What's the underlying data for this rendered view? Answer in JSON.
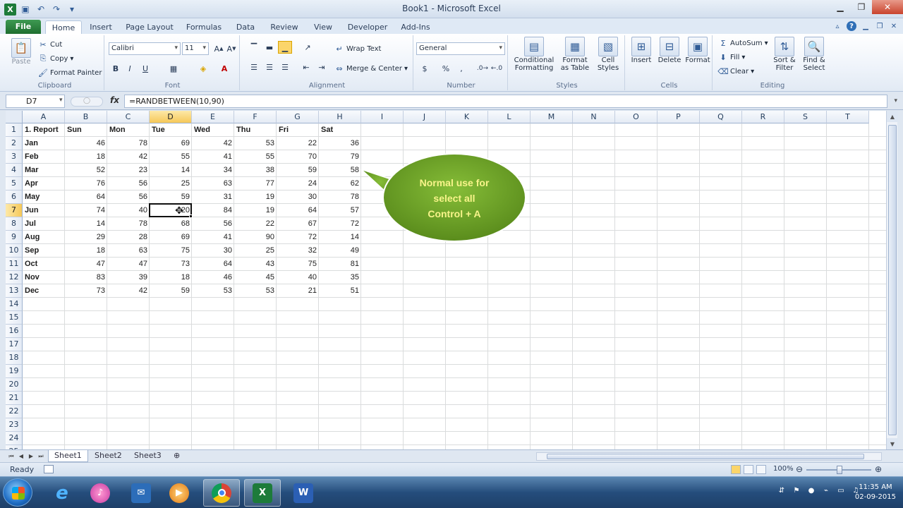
{
  "window": {
    "title": "Book1 - Microsoft Excel",
    "app_icon_letter": "X"
  },
  "tabs": [
    "File",
    "Home",
    "Insert",
    "Page Layout",
    "Formulas",
    "Data",
    "Review",
    "View",
    "Developer",
    "Add-Ins"
  ],
  "ribbon": {
    "clipboard": {
      "paste": "Paste",
      "cut": "Cut",
      "copy": "Copy",
      "format_painter": "Format Painter",
      "label": "Clipboard"
    },
    "font": {
      "name": "Calibri",
      "size": "11",
      "bold": "B",
      "italic": "I",
      "underline": "U",
      "label": "Font"
    },
    "alignment": {
      "wrap": "Wrap Text",
      "merge": "Merge & Center",
      "label": "Alignment"
    },
    "number": {
      "format": "General",
      "percent": "%",
      "comma": ",",
      "label": "Number"
    },
    "styles": {
      "conditional": [
        "Conditional",
        "Formatting"
      ],
      "format_table": [
        "Format",
        "as Table"
      ],
      "cell_styles": [
        "Cell",
        "Styles"
      ],
      "label": "Styles"
    },
    "cells": {
      "insert": "Insert",
      "delete": "Delete",
      "format": "Format",
      "label": "Cells"
    },
    "editing": {
      "autosum": "AutoSum",
      "fill": "Fill",
      "clear": "Clear",
      "sort": [
        "Sort &",
        "Filter"
      ],
      "find": [
        "Find &",
        "Select"
      ],
      "label": "Editing"
    }
  },
  "formula_bar": {
    "name_box": "D7",
    "fx": "fx",
    "formula": "=RANDBETWEEN(10,90)"
  },
  "columns": [
    "A",
    "B",
    "C",
    "D",
    "E",
    "F",
    "G",
    "H",
    "I",
    "J",
    "K",
    "L",
    "M",
    "N",
    "O",
    "P",
    "Q",
    "R",
    "S",
    "T"
  ],
  "rows": [
    "1",
    "2",
    "3",
    "4",
    "5",
    "6",
    "7",
    "8",
    "9",
    "10",
    "11",
    "12",
    "13",
    "14",
    "15",
    "16",
    "17",
    "18",
    "19",
    "20",
    "21",
    "22",
    "23",
    "24",
    "25"
  ],
  "table": {
    "headers": [
      "1. Report",
      "Sun",
      "Mon",
      "Tue",
      "Wed",
      "Thu",
      "Fri",
      "Sat"
    ],
    "data": [
      [
        "Jan",
        "46",
        "78",
        "69",
        "42",
        "53",
        "22",
        "36"
      ],
      [
        "Feb",
        "18",
        "42",
        "55",
        "41",
        "55",
        "70",
        "79"
      ],
      [
        "Mar",
        "52",
        "23",
        "14",
        "34",
        "38",
        "59",
        "58"
      ],
      [
        "Apr",
        "76",
        "56",
        "25",
        "63",
        "77",
        "24",
        "62"
      ],
      [
        "May",
        "64",
        "56",
        "59",
        "31",
        "19",
        "30",
        "78"
      ],
      [
        "Jun",
        "74",
        "40",
        "20",
        "84",
        "19",
        "64",
        "57"
      ],
      [
        "Jul",
        "14",
        "78",
        "68",
        "56",
        "22",
        "67",
        "72"
      ],
      [
        "Aug",
        "29",
        "28",
        "69",
        "41",
        "90",
        "72",
        "14"
      ],
      [
        "Sep",
        "18",
        "63",
        "75",
        "30",
        "25",
        "32",
        "49"
      ],
      [
        "Oct",
        "47",
        "47",
        "73",
        "64",
        "43",
        "75",
        "81"
      ],
      [
        "Nov",
        "83",
        "39",
        "18",
        "46",
        "45",
        "40",
        "35"
      ],
      [
        "Dec",
        "73",
        "42",
        "59",
        "53",
        "53",
        "21",
        "51"
      ]
    ]
  },
  "selection": {
    "column": "D",
    "row": "7"
  },
  "callout": {
    "lines": [
      "Normal use for",
      "select all",
      "Control + A"
    ],
    "color": "#6ea12a",
    "text_color": "#f8f48a"
  },
  "sheets": [
    "Sheet1",
    "Sheet2",
    "Sheet3"
  ],
  "status": {
    "ready": "Ready",
    "zoom": "100%"
  },
  "taskbar": {
    "apps": [
      "internet-explorer",
      "itunes",
      "outlook",
      "media-player",
      "chrome",
      "excel",
      "word"
    ],
    "clock_time": "11:35 AM",
    "clock_date": "02-09-2015"
  }
}
